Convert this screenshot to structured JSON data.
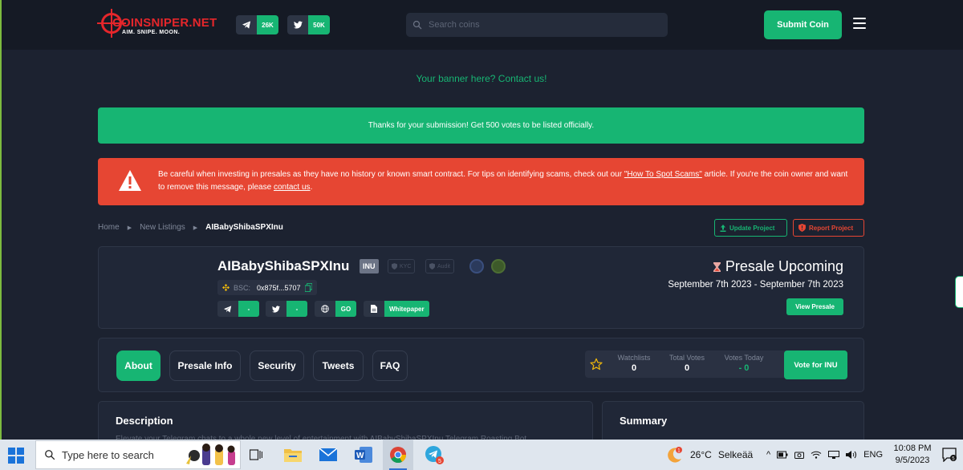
{
  "header": {
    "logo_name": "COINSNIPER.NET",
    "logo_tagline": "AIM. SNIPE. MOON.",
    "telegram_count": "26K",
    "twitter_count": "50K",
    "search_placeholder": "Search coins",
    "submit_label": "Submit Coin",
    "menu_icon": "hamburger-icon"
  },
  "banner": {
    "text": "Your banner here? Contact us!"
  },
  "notices": {
    "success": "Thanks for your submission! Get 500 votes to be listed officially.",
    "warning_part1": "Be careful when investing in presales as they have no history or known smart contract. For tips on identifying scams, check out our ",
    "warning_link1": "\"How To Spot Scams\"",
    "warning_part2": " article. If you're the coin owner and want to remove this message, please ",
    "warning_link2": "contact us",
    "warning_part3": "."
  },
  "breadcrumb": {
    "home": "Home",
    "section": "New Listings",
    "current": "AIBabyShibaSPXInu"
  },
  "actions": {
    "update": "Update Project",
    "report": "Report Project"
  },
  "coin": {
    "name": "AIBabyShibaSPXInu",
    "symbol": "INU",
    "kyc_badge": "KYC",
    "audit_badge": "Audit",
    "chain": "BSC:",
    "address": "0x875f...5707",
    "telegram_value": "-",
    "twitter_value": "-",
    "website_value": "GO",
    "whitepaper_label": "Whitepaper"
  },
  "presale": {
    "status": "Presale Upcoming",
    "dates": "September 7th 2023 - September 7th 2023",
    "button": "View Presale"
  },
  "tabs": [
    {
      "label": "About",
      "active": true
    },
    {
      "label": "Presale Info",
      "active": false
    },
    {
      "label": "Security",
      "active": false
    },
    {
      "label": "Tweets",
      "active": false
    },
    {
      "label": "FAQ",
      "active": false
    }
  ],
  "stats": {
    "watchlists_label": "Watchlists",
    "watchlists": "0",
    "total_votes_label": "Total Votes",
    "total_votes": "0",
    "votes_today_label": "Votes Today",
    "votes_today": "- 0",
    "vote_button": "Vote for INU"
  },
  "description": {
    "title": "Description",
    "preview": "Elevate your Telegram chats to a whole new level of entertainment with AIBabyShibaSPXInu Telegram Roasting Bot."
  },
  "summary": {
    "title": "Summary"
  },
  "taskbar": {
    "search_placeholder": "Type here to search",
    "weather_badge": "1",
    "temperature": "26°C",
    "condition": "Selkeää",
    "language": "ENG",
    "time": "10:08 PM",
    "date": "9/5/2023",
    "notification_count": "5"
  },
  "colors": {
    "accent": "#17b573",
    "danger": "#e64633",
    "background": "#1c2230",
    "card": "#202737"
  }
}
